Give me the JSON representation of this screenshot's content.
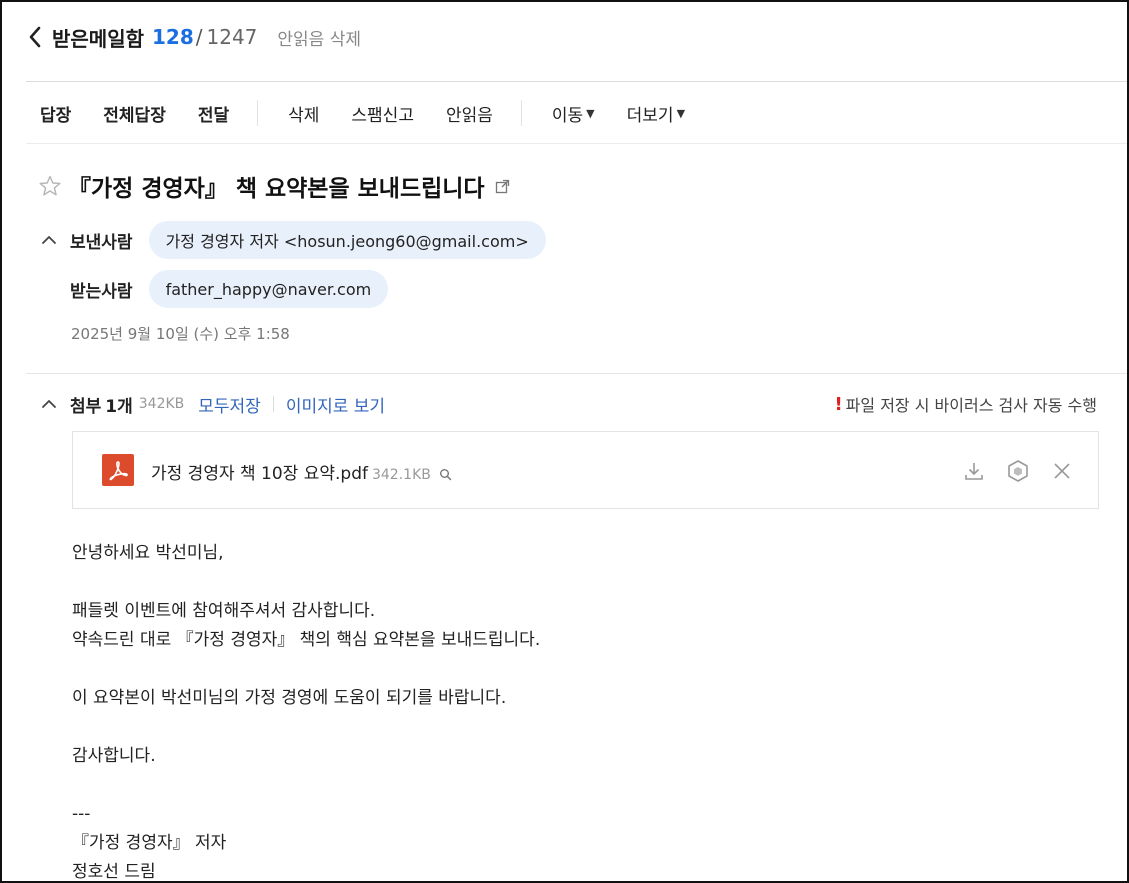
{
  "header": {
    "mailbox_title": "받은메일함",
    "unread_count": "128",
    "slash": "/",
    "total_count": "1247",
    "delete_unread": "안읽음 삭제"
  },
  "toolbar": {
    "reply": "답장",
    "reply_all": "전체답장",
    "forward": "전달",
    "delete": "삭제",
    "report_spam": "스팸신고",
    "mark_unread": "안읽음",
    "move": "이동",
    "more": "더보기"
  },
  "message": {
    "subject": "『가정 경영자』 책 요약본을 보내드립니다",
    "sender_label": "보낸사람",
    "sender": "가정 경영자 저자 <hosun.jeong60@gmail.com>",
    "recipient_label": "받는사람",
    "recipient": "father_happy@naver.com",
    "date": "2025년 9월 10일 (수) 오후 1:58"
  },
  "attachments": {
    "label": "첨부",
    "count": "1개",
    "total_size": "342KB",
    "save_all": "모두저장",
    "view_as_image": "이미지로 보기",
    "virus_note": "파일 저장 시 바이러스 검사 자동 수행",
    "files": [
      {
        "name": "가정 경영자 책 10장 요약.pdf",
        "size": "342.1KB"
      }
    ]
  },
  "body_lines": [
    "안녕하세요 박선미님,",
    "",
    "패들렛 이벤트에 참여해주셔서 감사합니다.",
    "약속드린 대로 『가정 경영자』 책의 핵심 요약본을 보내드립니다.",
    "",
    "이 요약본이 박선미님의 가정 경영에 도움이 되기를 바랍니다.",
    "",
    "감사합니다.",
    "",
    "---",
    "『가정 경영자』 저자",
    "정호선 드림"
  ],
  "colors": {
    "accent": "#1b6fe0",
    "link": "#3366bb",
    "chip_bg": "#e8f0fb",
    "pdf_red": "#dc4c2c",
    "warning": "#e02020"
  },
  "icons": [
    "chevron-left-icon",
    "star-outline-icon",
    "external-link-icon",
    "chevron-up-icon",
    "pdf-file-icon",
    "search-icon",
    "download-icon",
    "cube-icon",
    "close-icon",
    "exclamation-icon"
  ]
}
